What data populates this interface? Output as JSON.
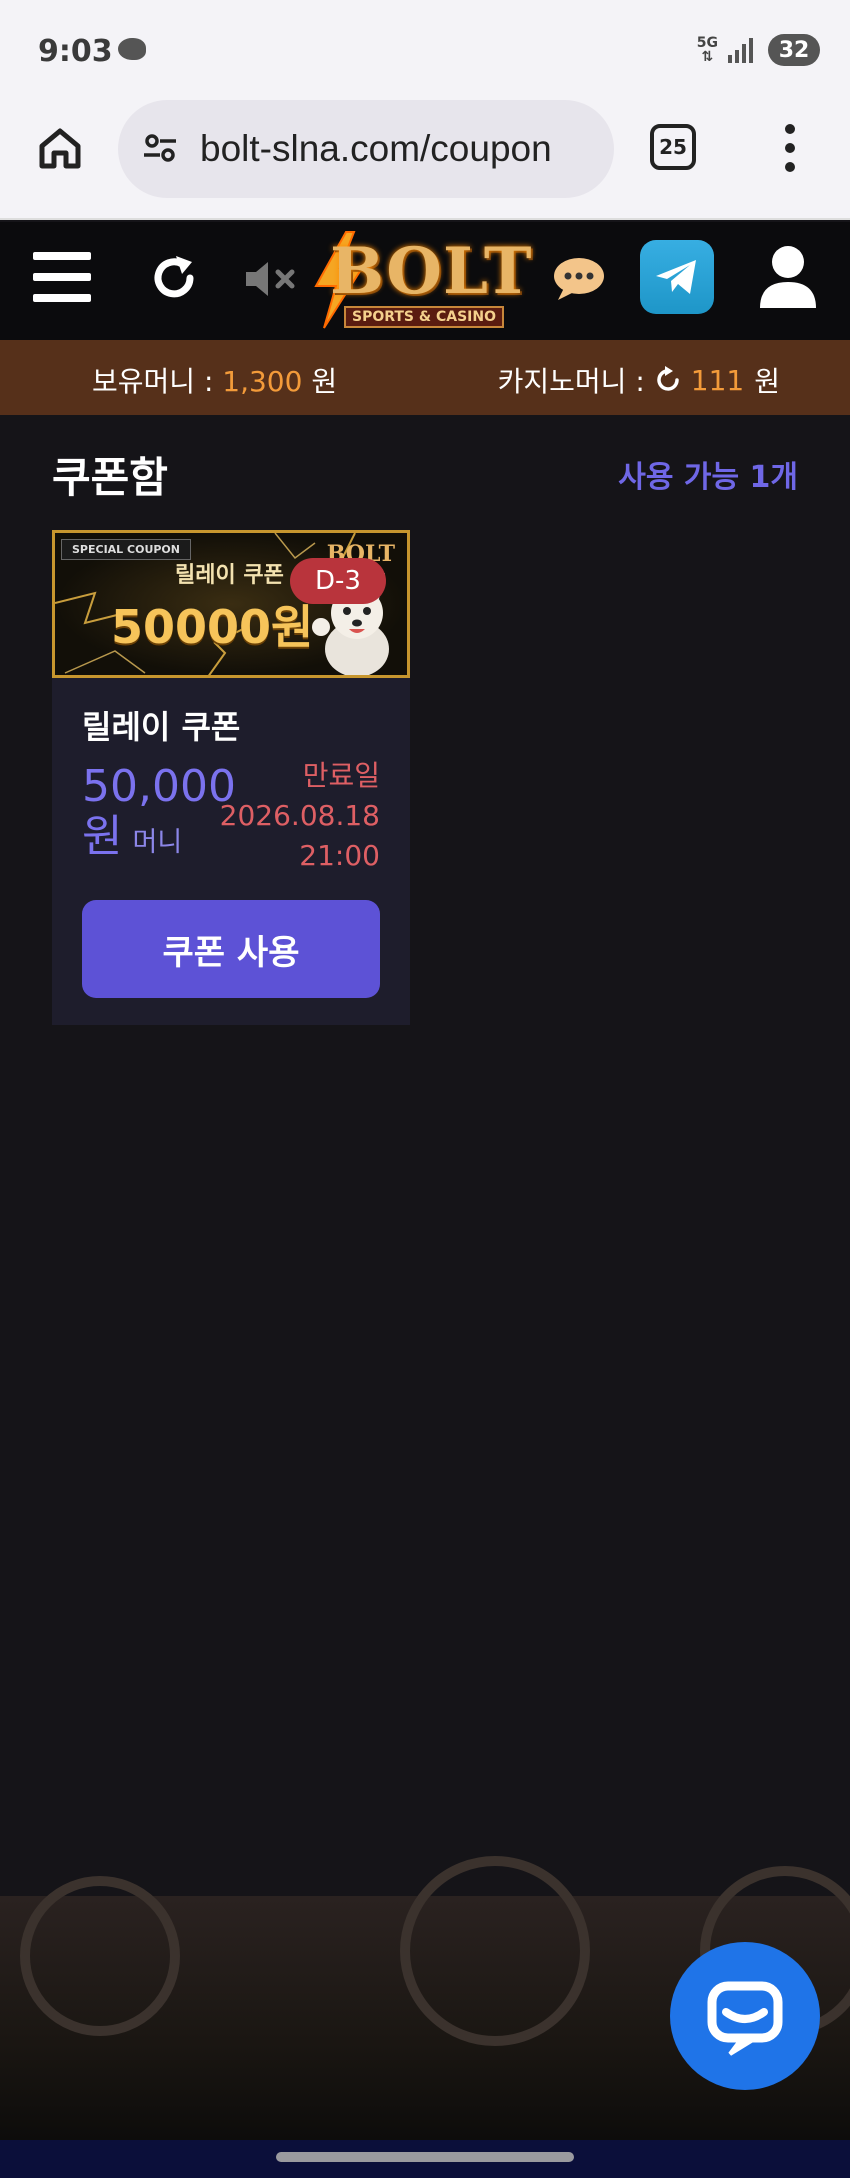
{
  "status_bar": {
    "time": "9:03",
    "network": "5G",
    "battery": "32"
  },
  "browser": {
    "url": "bolt-slna.com/coupon",
    "tab_count": "25"
  },
  "site": {
    "logo_text": "BOLT",
    "logo_sub": "SPORTS & CASINO"
  },
  "balance": {
    "money_label": "보유머니 :",
    "money_value": "1,300",
    "money_unit": "원",
    "casino_label": "카지노머니 :",
    "casino_value": "111",
    "casino_unit": "원"
  },
  "coupon_box": {
    "title": "쿠폰함",
    "available": "사용 가능 1개"
  },
  "coupon": {
    "banner_tag": "SPECIAL COUPON",
    "banner_title": "릴레이 쿠폰",
    "banner_amount": "50000원",
    "banner_logo": "BOLT",
    "dday": "D-3",
    "name": "릴레이 쿠폰",
    "amount": "50,000",
    "amount_unit": "원",
    "type": "머니",
    "expire_label": "만료일",
    "expire_date": "2026.08.18",
    "expire_time": "21:00",
    "button_label": "쿠폰 사용"
  },
  "colors": {
    "accent": "#5d52d6",
    "amount": "#7b72ee",
    "expire": "#de5f64",
    "balance_bar": "#56301a",
    "highlight": "#f39b3a"
  }
}
